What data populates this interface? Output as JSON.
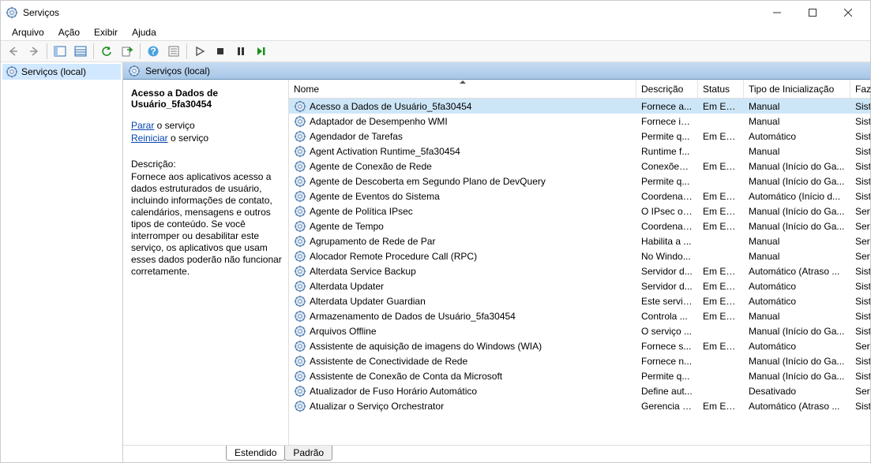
{
  "window": {
    "title": "Serviços"
  },
  "menu": {
    "file": "Arquivo",
    "action": "Ação",
    "view": "Exibir",
    "help": "Ajuda"
  },
  "tree": {
    "root": "Serviços (local)"
  },
  "section": {
    "title": "Serviços (local)"
  },
  "detail": {
    "selected_title": "Acesso a Dados de Usuário_5fa30454",
    "stop_link": "Parar",
    "stop_suffix": " o serviço",
    "restart_link": "Reiniciar",
    "restart_suffix": " o serviço",
    "desc_label": "Descrição:",
    "desc_text": "Fornece aos aplicativos acesso a dados estruturados de usuário, incluindo informações de contato, calendários, mensagens e outros tipos de conteúdo. Se você interromper ou desabilitar este serviço, os aplicativos que usam esses dados poderão não funcionar corretamente."
  },
  "columns": {
    "name": "Nome",
    "description": "Descrição",
    "status": "Status",
    "startup": "Tipo de Inicialização",
    "logon": "Fazer"
  },
  "tabs": {
    "extended": "Estendido",
    "standard": "Padrão"
  },
  "services": [
    {
      "name": "Acesso a Dados de Usuário_5fa30454",
      "desc": "Fornece a...",
      "status": "Em Exe...",
      "startup": "Manual",
      "logon": "Sister",
      "selected": true
    },
    {
      "name": "Adaptador de Desempenho WMI",
      "desc": "Fornece in...",
      "status": "",
      "startup": "Manual",
      "logon": "Sister"
    },
    {
      "name": "Agendador de Tarefas",
      "desc": "Permite q...",
      "status": "Em Exe...",
      "startup": "Automático",
      "logon": "Sister"
    },
    {
      "name": "Agent Activation Runtime_5fa30454",
      "desc": "Runtime f...",
      "status": "",
      "startup": "Manual",
      "logon": "Sister"
    },
    {
      "name": "Agente de Conexão de Rede",
      "desc": "Conexões ...",
      "status": "Em Exe...",
      "startup": "Manual (Início do Ga...",
      "logon": "Sister"
    },
    {
      "name": "Agente de Descoberta em Segundo Plano de DevQuery",
      "desc": "Permite q...",
      "status": "",
      "startup": "Manual (Início do Ga...",
      "logon": "Sister"
    },
    {
      "name": "Agente de Eventos do Sistema",
      "desc": "Coordena ...",
      "status": "Em Exe...",
      "startup": "Automático (Início d...",
      "logon": "Sister"
    },
    {
      "name": "Agente de Política IPsec",
      "desc": "O IPsec of...",
      "status": "Em Exe...",
      "startup": "Manual (Início do Ga...",
      "logon": "Serviç"
    },
    {
      "name": "Agente de Tempo",
      "desc": "Coordena ...",
      "status": "Em Exe...",
      "startup": "Manual (Início do Ga...",
      "logon": "Serviç"
    },
    {
      "name": "Agrupamento de Rede de Par",
      "desc": "Habilita a ...",
      "status": "",
      "startup": "Manual",
      "logon": "Serviç"
    },
    {
      "name": "Alocador Remote Procedure Call (RPC)",
      "desc": "No Windo...",
      "status": "",
      "startup": "Manual",
      "logon": "Serviç"
    },
    {
      "name": "Alterdata Service Backup",
      "desc": "Servidor d...",
      "status": "Em Exe...",
      "startup": "Automático (Atraso ...",
      "logon": "Sister"
    },
    {
      "name": "Alterdata Updater",
      "desc": "Servidor d...",
      "status": "Em Exe...",
      "startup": "Automático",
      "logon": "Sister"
    },
    {
      "name": "Alterdata Updater Guardian",
      "desc": "Este serviç...",
      "status": "Em Exe...",
      "startup": "Automático",
      "logon": "Sister"
    },
    {
      "name": "Armazenamento de Dados de Usuário_5fa30454",
      "desc": "Controla ...",
      "status": "Em Exe...",
      "startup": "Manual",
      "logon": "Sister"
    },
    {
      "name": "Arquivos Offline",
      "desc": "O serviço ...",
      "status": "",
      "startup": "Manual (Início do Ga...",
      "logon": "Sister"
    },
    {
      "name": "Assistente de aquisição de imagens do Windows (WIA)",
      "desc": "Fornece s...",
      "status": "Em Exe...",
      "startup": "Automático",
      "logon": "Serviç"
    },
    {
      "name": "Assistente de Conectividade de Rede",
      "desc": "Fornece n...",
      "status": "",
      "startup": "Manual (Início do Ga...",
      "logon": "Sister"
    },
    {
      "name": "Assistente de Conexão de Conta da Microsoft",
      "desc": "Permite q...",
      "status": "",
      "startup": "Manual (Início do Ga...",
      "logon": "Sister"
    },
    {
      "name": "Atualizador de Fuso Horário Automático",
      "desc": "Define aut...",
      "status": "",
      "startup": "Desativado",
      "logon": "Serviç"
    },
    {
      "name": "Atualizar o Serviço Orchestrator",
      "desc": "Gerencia a...",
      "status": "Em Exe...",
      "startup": "Automático (Atraso ...",
      "logon": "Sister"
    }
  ]
}
